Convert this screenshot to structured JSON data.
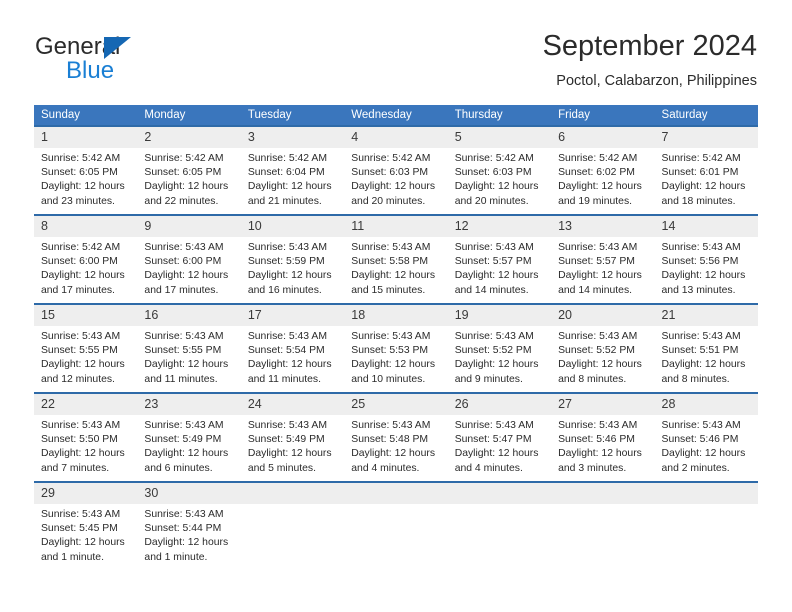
{
  "brand": {
    "name_top": "General",
    "name_bottom": "Blue",
    "triangle_color": "#1567b3",
    "blue_color": "#1a7fd4"
  },
  "header": {
    "title": "September 2024",
    "subtitle": "Poctol, Calabarzon, Philippines"
  },
  "theme": {
    "header_bg": "#3a76bd",
    "row_border": "#2e6aa8",
    "daynum_bg": "#eeeeee",
    "text": "#2b2b2b"
  },
  "weekday_headers": [
    "Sunday",
    "Monday",
    "Tuesday",
    "Wednesday",
    "Thursday",
    "Friday",
    "Saturday"
  ],
  "weeks": [
    [
      {
        "day": "1",
        "sunrise": "Sunrise: 5:42 AM",
        "sunset": "Sunset: 6:05 PM",
        "daylight1": "Daylight: 12 hours",
        "daylight2": "and 23 minutes."
      },
      {
        "day": "2",
        "sunrise": "Sunrise: 5:42 AM",
        "sunset": "Sunset: 6:05 PM",
        "daylight1": "Daylight: 12 hours",
        "daylight2": "and 22 minutes."
      },
      {
        "day": "3",
        "sunrise": "Sunrise: 5:42 AM",
        "sunset": "Sunset: 6:04 PM",
        "daylight1": "Daylight: 12 hours",
        "daylight2": "and 21 minutes."
      },
      {
        "day": "4",
        "sunrise": "Sunrise: 5:42 AM",
        "sunset": "Sunset: 6:03 PM",
        "daylight1": "Daylight: 12 hours",
        "daylight2": "and 20 minutes."
      },
      {
        "day": "5",
        "sunrise": "Sunrise: 5:42 AM",
        "sunset": "Sunset: 6:03 PM",
        "daylight1": "Daylight: 12 hours",
        "daylight2": "and 20 minutes."
      },
      {
        "day": "6",
        "sunrise": "Sunrise: 5:42 AM",
        "sunset": "Sunset: 6:02 PM",
        "daylight1": "Daylight: 12 hours",
        "daylight2": "and 19 minutes."
      },
      {
        "day": "7",
        "sunrise": "Sunrise: 5:42 AM",
        "sunset": "Sunset: 6:01 PM",
        "daylight1": "Daylight: 12 hours",
        "daylight2": "and 18 minutes."
      }
    ],
    [
      {
        "day": "8",
        "sunrise": "Sunrise: 5:42 AM",
        "sunset": "Sunset: 6:00 PM",
        "daylight1": "Daylight: 12 hours",
        "daylight2": "and 17 minutes."
      },
      {
        "day": "9",
        "sunrise": "Sunrise: 5:43 AM",
        "sunset": "Sunset: 6:00 PM",
        "daylight1": "Daylight: 12 hours",
        "daylight2": "and 17 minutes."
      },
      {
        "day": "10",
        "sunrise": "Sunrise: 5:43 AM",
        "sunset": "Sunset: 5:59 PM",
        "daylight1": "Daylight: 12 hours",
        "daylight2": "and 16 minutes."
      },
      {
        "day": "11",
        "sunrise": "Sunrise: 5:43 AM",
        "sunset": "Sunset: 5:58 PM",
        "daylight1": "Daylight: 12 hours",
        "daylight2": "and 15 minutes."
      },
      {
        "day": "12",
        "sunrise": "Sunrise: 5:43 AM",
        "sunset": "Sunset: 5:57 PM",
        "daylight1": "Daylight: 12 hours",
        "daylight2": "and 14 minutes."
      },
      {
        "day": "13",
        "sunrise": "Sunrise: 5:43 AM",
        "sunset": "Sunset: 5:57 PM",
        "daylight1": "Daylight: 12 hours",
        "daylight2": "and 14 minutes."
      },
      {
        "day": "14",
        "sunrise": "Sunrise: 5:43 AM",
        "sunset": "Sunset: 5:56 PM",
        "daylight1": "Daylight: 12 hours",
        "daylight2": "and 13 minutes."
      }
    ],
    [
      {
        "day": "15",
        "sunrise": "Sunrise: 5:43 AM",
        "sunset": "Sunset: 5:55 PM",
        "daylight1": "Daylight: 12 hours",
        "daylight2": "and 12 minutes."
      },
      {
        "day": "16",
        "sunrise": "Sunrise: 5:43 AM",
        "sunset": "Sunset: 5:55 PM",
        "daylight1": "Daylight: 12 hours",
        "daylight2": "and 11 minutes."
      },
      {
        "day": "17",
        "sunrise": "Sunrise: 5:43 AM",
        "sunset": "Sunset: 5:54 PM",
        "daylight1": "Daylight: 12 hours",
        "daylight2": "and 11 minutes."
      },
      {
        "day": "18",
        "sunrise": "Sunrise: 5:43 AM",
        "sunset": "Sunset: 5:53 PM",
        "daylight1": "Daylight: 12 hours",
        "daylight2": "and 10 minutes."
      },
      {
        "day": "19",
        "sunrise": "Sunrise: 5:43 AM",
        "sunset": "Sunset: 5:52 PM",
        "daylight1": "Daylight: 12 hours",
        "daylight2": "and 9 minutes."
      },
      {
        "day": "20",
        "sunrise": "Sunrise: 5:43 AM",
        "sunset": "Sunset: 5:52 PM",
        "daylight1": "Daylight: 12 hours",
        "daylight2": "and 8 minutes."
      },
      {
        "day": "21",
        "sunrise": "Sunrise: 5:43 AM",
        "sunset": "Sunset: 5:51 PM",
        "daylight1": "Daylight: 12 hours",
        "daylight2": "and 8 minutes."
      }
    ],
    [
      {
        "day": "22",
        "sunrise": "Sunrise: 5:43 AM",
        "sunset": "Sunset: 5:50 PM",
        "daylight1": "Daylight: 12 hours",
        "daylight2": "and 7 minutes."
      },
      {
        "day": "23",
        "sunrise": "Sunrise: 5:43 AM",
        "sunset": "Sunset: 5:49 PM",
        "daylight1": "Daylight: 12 hours",
        "daylight2": "and 6 minutes."
      },
      {
        "day": "24",
        "sunrise": "Sunrise: 5:43 AM",
        "sunset": "Sunset: 5:49 PM",
        "daylight1": "Daylight: 12 hours",
        "daylight2": "and 5 minutes."
      },
      {
        "day": "25",
        "sunrise": "Sunrise: 5:43 AM",
        "sunset": "Sunset: 5:48 PM",
        "daylight1": "Daylight: 12 hours",
        "daylight2": "and 4 minutes."
      },
      {
        "day": "26",
        "sunrise": "Sunrise: 5:43 AM",
        "sunset": "Sunset: 5:47 PM",
        "daylight1": "Daylight: 12 hours",
        "daylight2": "and 4 minutes."
      },
      {
        "day": "27",
        "sunrise": "Sunrise: 5:43 AM",
        "sunset": "Sunset: 5:46 PM",
        "daylight1": "Daylight: 12 hours",
        "daylight2": "and 3 minutes."
      },
      {
        "day": "28",
        "sunrise": "Sunrise: 5:43 AM",
        "sunset": "Sunset: 5:46 PM",
        "daylight1": "Daylight: 12 hours",
        "daylight2": "and 2 minutes."
      }
    ],
    [
      {
        "day": "29",
        "sunrise": "Sunrise: 5:43 AM",
        "sunset": "Sunset: 5:45 PM",
        "daylight1": "Daylight: 12 hours",
        "daylight2": "and 1 minute."
      },
      {
        "day": "30",
        "sunrise": "Sunrise: 5:43 AM",
        "sunset": "Sunset: 5:44 PM",
        "daylight1": "Daylight: 12 hours",
        "daylight2": "and 1 minute."
      },
      {
        "day": "",
        "sunrise": "",
        "sunset": "",
        "daylight1": "",
        "daylight2": ""
      },
      {
        "day": "",
        "sunrise": "",
        "sunset": "",
        "daylight1": "",
        "daylight2": ""
      },
      {
        "day": "",
        "sunrise": "",
        "sunset": "",
        "daylight1": "",
        "daylight2": ""
      },
      {
        "day": "",
        "sunrise": "",
        "sunset": "",
        "daylight1": "",
        "daylight2": ""
      },
      {
        "day": "",
        "sunrise": "",
        "sunset": "",
        "daylight1": "",
        "daylight2": ""
      }
    ]
  ]
}
